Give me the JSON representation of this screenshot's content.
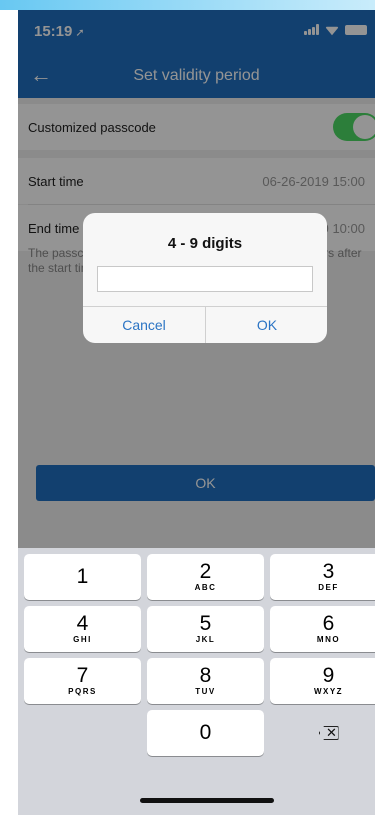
{
  "statusbar": {
    "time": "15:19",
    "location_arrow": "➚"
  },
  "navbar": {
    "back_icon": "←",
    "title": "Set validity period"
  },
  "rows": {
    "custom_passcode_label": "Customized passcode",
    "start_label": "Start time",
    "start_value": "06-26-2019 15:00",
    "end_label": "End time",
    "end_value": "07-02-2019 10:00"
  },
  "hint_text": "The passcode must be used at least once within 24 hours after the start time",
  "ok_button_label": "OK",
  "dialog": {
    "title": "4 - 9 digits",
    "input_value": "",
    "cancel_label": "Cancel",
    "ok_label": "OK"
  },
  "keyboard": {
    "keys": [
      {
        "num": "1",
        "letters": ""
      },
      {
        "num": "2",
        "letters": "ABC"
      },
      {
        "num": "3",
        "letters": "DEF"
      },
      {
        "num": "4",
        "letters": "GHI"
      },
      {
        "num": "5",
        "letters": "JKL"
      },
      {
        "num": "6",
        "letters": "MNO"
      },
      {
        "num": "7",
        "letters": "PQRS"
      },
      {
        "num": "8",
        "letters": "TUV"
      },
      {
        "num": "9",
        "letters": "WXYZ"
      },
      {
        "num": "0",
        "letters": ""
      }
    ],
    "delete_icon": "⌫"
  },
  "colors": {
    "brand": "#1f6fbf",
    "toggle_on": "#4cd964",
    "dialog_button": "#2b74c4"
  }
}
